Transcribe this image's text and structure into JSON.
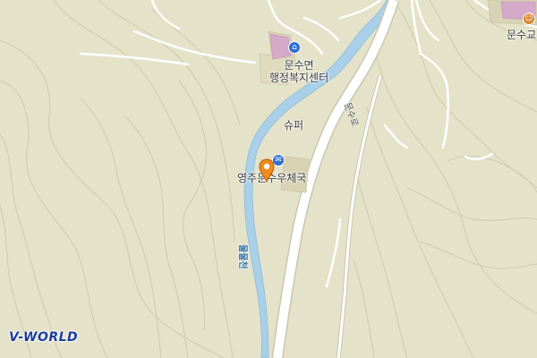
{
  "map": {
    "labels": {
      "office_line1": "문수면",
      "office_line2": "행정복지센터",
      "super": "슈퍼",
      "post_office": "영주문수우체국",
      "school": "문수교",
      "road": "문수로",
      "river": "물물천"
    },
    "logo": "V-WORLD",
    "colors": {
      "land": "#e4e2c9",
      "river": "#a9d0e8",
      "road": "#ffffff",
      "contour": "#d2ceb0",
      "marker": "#f08a1e",
      "office_icon": "#2f6fd2",
      "post_icon": "#2f6fd2",
      "school_icon": "#d9822b"
    },
    "icons": {
      "office": "government-office-icon",
      "post": "post-office-icon",
      "school": "school-icon",
      "marker": "location-marker-icon"
    }
  }
}
